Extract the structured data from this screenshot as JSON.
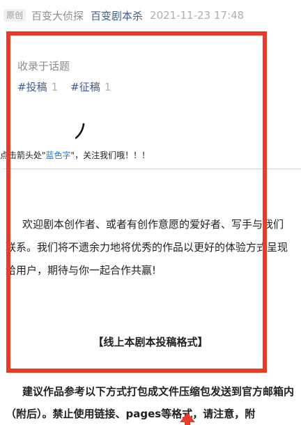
{
  "meta": {
    "original_tag": "原创",
    "author": "百变大侦探",
    "account": "百变剧本杀",
    "date": "2021-11-23 17:48"
  },
  "topics": {
    "title": "收录于话题",
    "tags": [
      {
        "label": "#投稿",
        "count": "1"
      },
      {
        "label": "#征稿",
        "count": "1"
      }
    ]
  },
  "follow": {
    "prefix": "点击箭头处\"",
    "blue_text": "蓝色字",
    "suffix": "\"，关注我们哦！！！"
  },
  "article": {
    "welcome": "欢迎剧本创作者、或者有创作意愿的爱好者、写手与我们联系。我们将不遗余力地将优秀的作品以更好的体验方式呈现给用户，期待与你一起合作共赢!",
    "format_title": "【线上本剧本投稿格式】",
    "advice": "建议作品参考以下方式打包成文件压缩包发送到官方邮箱内（附后）。禁止使用链接、pages等格式，请注意，附"
  },
  "colors": {
    "highlight": "#ea3b26",
    "link_blue": "#3f5c92"
  }
}
